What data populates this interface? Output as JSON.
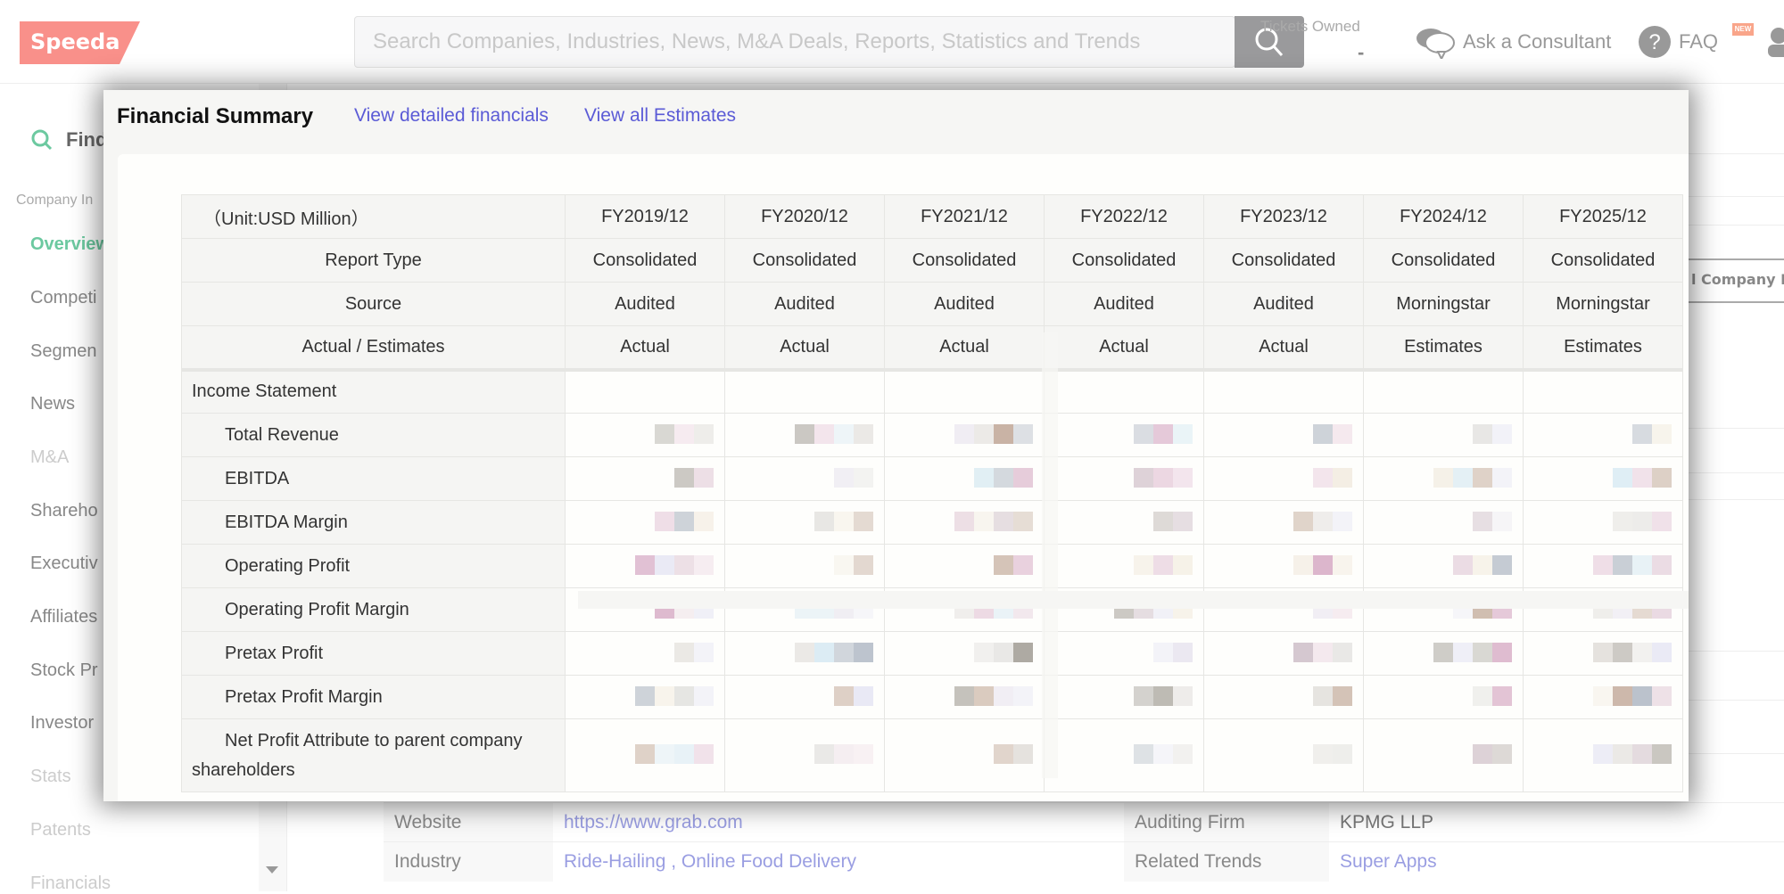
{
  "header": {
    "logo": "Speeda",
    "search_placeholder": "Search Companies, Industries, News, M&A Deals, Reports, Statistics and Trends",
    "tickets_label": "Tickets Owned",
    "tickets_value": "-",
    "ask_consultant": "Ask a Consultant",
    "faq": "FAQ",
    "new_badge": "NEW",
    "logo_color": "#f9908a"
  },
  "sidebar": {
    "find_label": "Find",
    "section_label": "Company In",
    "items": [
      {
        "label": "Overview",
        "state": "active"
      },
      {
        "label": "Competi",
        "state": "normal"
      },
      {
        "label": "Segmen",
        "state": "normal"
      },
      {
        "label": "News",
        "state": "normal"
      },
      {
        "label": "M&A",
        "state": "disabled"
      },
      {
        "label": "Shareho",
        "state": "normal"
      },
      {
        "label": "Executiv",
        "state": "normal"
      },
      {
        "label": "Affiliates",
        "state": "normal"
      },
      {
        "label": "Stock Pr",
        "state": "normal"
      },
      {
        "label": "Investor",
        "state": "normal"
      },
      {
        "label": "Stats",
        "state": "disabled"
      },
      {
        "label": "Patents",
        "state": "disabled"
      },
      {
        "label": "Financials",
        "state": "disabled"
      }
    ]
  },
  "background": {
    "company_tab": "l Company P",
    "info_rows": [
      {
        "label": "Website",
        "value": "https://www.grab.com",
        "label2": "Auditing Firm",
        "value2": "KPMG LLP"
      },
      {
        "label": "Industry",
        "value": "Ride-Hailing , Online Food Delivery",
        "label2": "Related Trends",
        "value2": "Super Apps"
      }
    ]
  },
  "modal": {
    "title": "Financial Summary",
    "link_detailed": "View detailed financials",
    "link_estimates": "View all Estimates",
    "table": {
      "unit": "（Unit:USD Million）",
      "years": [
        "FY2019/12",
        "FY2020/12",
        "FY2021/12",
        "FY2022/12",
        "FY2023/12",
        "FY2024/12",
        "FY2025/12"
      ],
      "report_type_label": "Report Type",
      "report_type": [
        "Consolidated",
        "Consolidated",
        "Consolidated",
        "Consolidated",
        "Consolidated",
        "Consolidated",
        "Consolidated"
      ],
      "source_label": "Source",
      "source": [
        "Audited",
        "Audited",
        "Audited",
        "Audited",
        "Audited",
        "Morningstar",
        "Morningstar"
      ],
      "actual_label": "Actual / Estimates",
      "actual": [
        "Actual",
        "Actual",
        "Actual",
        "Actual",
        "Actual",
        "Estimates",
        "Estimates"
      ],
      "section": "Income Statement",
      "metrics": [
        "Total Revenue",
        "EBITDA",
        "EBITDA Margin",
        "Operating Profit",
        "Operating Profit Margin",
        "Pretax Profit",
        "Pretax Profit Margin",
        "Net Profit Attribute to parent company shareholders"
      ],
      "values_note": "pixelated / obscured"
    }
  }
}
